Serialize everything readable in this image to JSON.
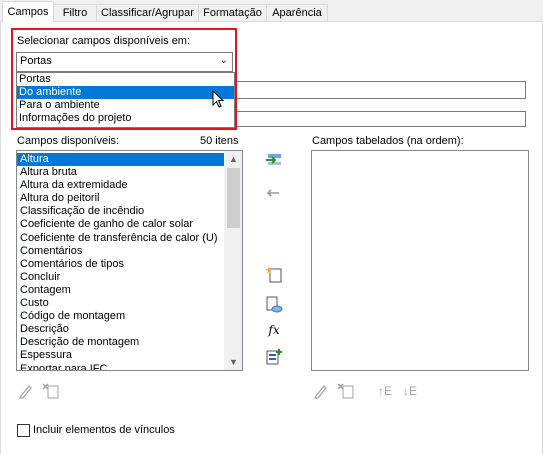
{
  "tabs": [
    "Campos",
    "Filtro",
    "Classificar/Agrupar",
    "Formatação",
    "Aparência"
  ],
  "select_label": "Selecionar campos disponíveis em:",
  "select_value": "Portas",
  "dropdown_options": [
    "Portas",
    "Do ambiente",
    "Para o ambiente",
    "Informações do projeto"
  ],
  "highlighted_option": "Do ambiente",
  "available_label": "Campos disponíveis:",
  "available_count": "50 itens",
  "scheduled_label": "Campos tabelados (na ordem):",
  "available_fields": [
    "Altura",
    "Altura bruta",
    "Altura da extremidade",
    "Altura do peitoril",
    "Classificação de incêndio",
    "Coeficiente de ganho de calor solar",
    "Coeficiente de transferência de calor (U)",
    "Comentários",
    "Comentários de tipos",
    "Concluir",
    "Contagem",
    "Custo",
    "Código de montagem",
    "Descrição",
    "Descrição de montagem",
    "Espessura",
    "Exportar para IFC"
  ],
  "include_links_label": "Incluir elementos de vínculos",
  "fx_symbol": "fx",
  "move_up_label": "↑E",
  "move_down_label": "↓E"
}
